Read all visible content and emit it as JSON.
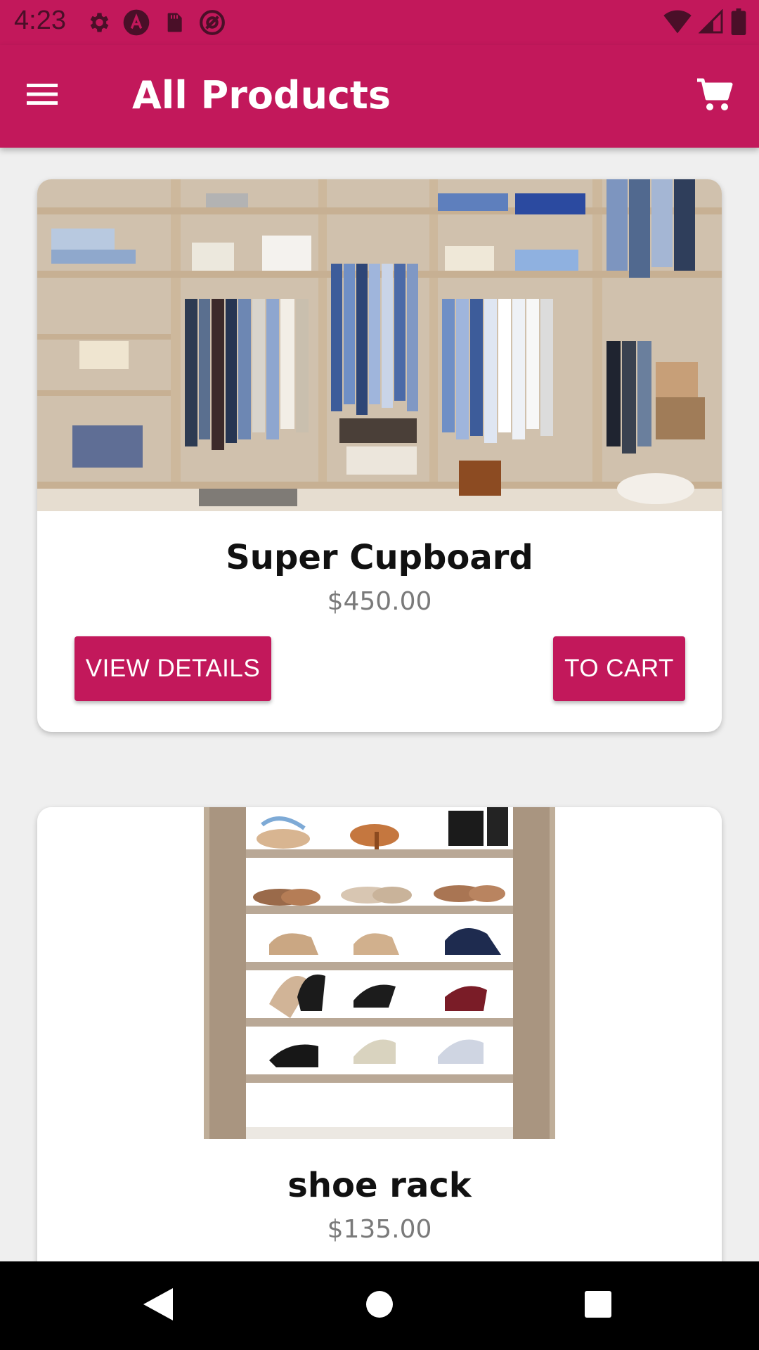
{
  "status_bar": {
    "time": "4:23",
    "left_icons": [
      "gear-icon",
      "app-a-icon",
      "sd-card-icon",
      "at-sign-icon"
    ],
    "right_icons": [
      "wifi-icon",
      "cellular-signal-icon",
      "battery-icon"
    ]
  },
  "app_bar": {
    "title": "All Products",
    "menu_icon": "hamburger-menu-icon",
    "cart_icon": "shopping-cart-icon"
  },
  "products": [
    {
      "name": "Super Cupboard",
      "price": "$450.00",
      "image": "wardrobe-closet-photo",
      "view_details_label": "VIEW DETAILS",
      "to_cart_label": "TO CART"
    },
    {
      "name": "shoe rack",
      "price": "$135.00",
      "image": "shoe-rack-photo"
    }
  ],
  "nav_bar": {
    "buttons": [
      "back-icon",
      "home-icon",
      "recent-apps-icon"
    ]
  },
  "colors": {
    "primary": "#c2185b",
    "background": "#efefef",
    "card": "#ffffff",
    "price_text": "#7a7a7a",
    "nav_bar": "#000000"
  }
}
